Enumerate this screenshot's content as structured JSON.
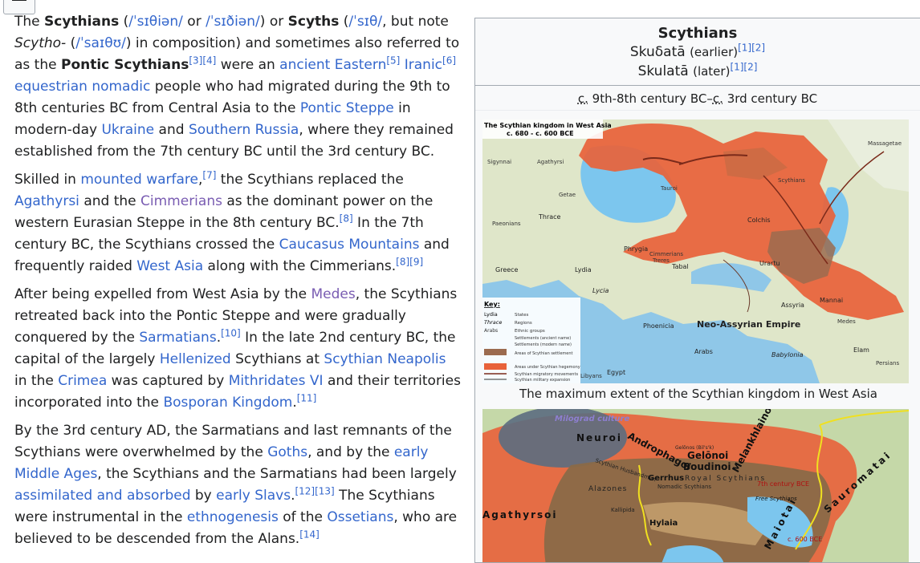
{
  "article": {
    "p1": {
      "t1": "The ",
      "name1": "Scythians",
      "t2": " (",
      "ipa1": "/ˈsɪθiən/",
      "t3": " or ",
      "ipa2": "/ˈsɪðiən/",
      "t4": ") or ",
      "name2": "Scyths",
      "t5": " (",
      "ipa3": "/ˈsɪθ/",
      "t6": ", but note ",
      "prefix": "Scytho-",
      "t7": " (",
      "ipa4": "/ˈsaɪθʊ/",
      "t8": ") in composition) and sometimes also referred to as the ",
      "name3": "Pontic Scythians",
      "ref1": "[3][4]",
      "t9": " were an ",
      "link1": "ancient Eastern",
      "ref2": "[5]",
      "t10": " ",
      "link2": "Iranic",
      "ref3": "[6]",
      "t11": " ",
      "link3": "equestrian nomadic",
      "t12": " people who had migrated during the 9th to 8th centuries BC from Central Asia to the ",
      "link4": "Pontic Steppe",
      "t13": " in modern-day ",
      "link5": "Ukraine",
      "t14": " and ",
      "link6": "Southern Russia",
      "t15": ", where they remained established from the 7th century BC until the 3rd century BC."
    },
    "p2": {
      "t1": "Skilled in ",
      "link1": "mounted warfare",
      "t2": ",",
      "ref1": "[7]",
      "t3": " the Scythians replaced the ",
      "link2": "Agathyrsi",
      "t4": " and the ",
      "link3": "Cimmerians",
      "t5": " as the dominant power on the western Eurasian Steppe in the 8th century BC.",
      "ref2": "[8]",
      "t6": " In the 7th century BC, the Scythians crossed the ",
      "link4": "Caucasus Mountains",
      "t7": " and frequently raided ",
      "link5": "West Asia",
      "t8": " along with the Cimmerians.",
      "ref3": "[8][9]"
    },
    "p3": {
      "t1": "After being expelled from West Asia by the ",
      "link1": "Medes",
      "t2": ", the Scythians retreated back into the Pontic Steppe and were gradually conquered by the ",
      "link2": "Sarmatians",
      "t3": ".",
      "ref1": "[10]",
      "t4": " In the late 2nd century BC, the capital of the largely ",
      "link3": "Hellenized",
      "t5": " Scythians at ",
      "link4": "Scythian Neapolis",
      "t6": " in the ",
      "link5": "Crimea",
      "t7": " was captured by ",
      "link6": "Mithridates VI",
      "t8": " and their territories incorporated into the ",
      "link7": "Bosporan Kingdom",
      "t9": ".",
      "ref2": "[11]"
    },
    "p4": {
      "t1": "By the 3rd century AD, the Sarmatians and last remnants of the Scythians were overwhelmed by the ",
      "link1": "Goths",
      "t2": ", and by the ",
      "link2": "early Middle Ages",
      "t3": ", the Scythians and the Sarmatians had been largely ",
      "link3": "assimilated and absorbed",
      "t4": " by ",
      "link4": "early Slavs",
      "t5": ".",
      "ref1": "[12][13]",
      "t6": " The Scythians were instrumental in the ",
      "link5": "ethnogenesis",
      "t7": " of the ",
      "link6": "Ossetians",
      "t8": ", who are believed to be descended from the Alans.",
      "ref2": "[14]"
    }
  },
  "infobox": {
    "title": "Scythians",
    "name_early": "Skuδatā",
    "name_early_note": "(earlier)",
    "name_early_ref": "[1][2]",
    "name_late": "Skulatā",
    "name_late_note": "(later)",
    "name_late_ref": "[1][2]",
    "date_c1": "c.",
    "date_mid": " 9th-8th century BC–",
    "date_c2": "c.",
    "date_end": " 3rd century BC",
    "map1_caption": "The maximum extent of the Scythian kingdom in West Asia",
    "map1_labels": {
      "title_line1": "The Scythian kingdom in West Asia",
      "title_line2": "c. 680 - c. 600 BCE",
      "signynai": "Sigynnai",
      "agathyrsi": "Agathyrsi",
      "getae": "Getae",
      "tauroi": "Tauroi",
      "thrace": "Thrace",
      "paeonians": "Paeonians",
      "colchis": "Colchis",
      "massagetae": "Massagetae",
      "scythians": "Scythians",
      "phrygia": "Phrygia",
      "cimmerians": "Cimmerians",
      "treres": "Treres",
      "tabal": "Tabal",
      "urartu": "Urartu",
      "greece": "Greece",
      "lydia": "Lydia",
      "lycia": "Lycia",
      "assyria": "Assyria",
      "mannai": "Mannai",
      "medes": "Medes",
      "phoenicia": "Phoenicia",
      "neo_assyrian": "Neo-Assyrian Empire",
      "arabs": "Arabs",
      "babylonia": "Babylonia",
      "elam": "Elam",
      "persians": "Persians",
      "libyans": "Libyans",
      "egypt": "Egypt",
      "key_title": "Key:",
      "key_lydia": "Lydia",
      "key_thrace": "Thrace",
      "key_arabs": "Arabs",
      "key_states": "States",
      "key_regions": "Regions",
      "key_ethnic": "Ethnic groups",
      "key_settlements_ancient": "Settlements (ancient name)",
      "key_settlements_modern": "Settlements (modern name)",
      "key_scythian_settlement": "Areas of Scythian settlement",
      "key_hegemony": "Areas under Scythian hegemony",
      "key_migratory": "Scythian migratory movements",
      "key_military": "Scythian military expansion"
    },
    "map2_labels": {
      "milograd": "Milograd culture",
      "neuroi": "Neuroi",
      "androphagoi": "Androphagoi",
      "gelonoi": "Gelōnoi",
      "boudinoi": "Boudinoi",
      "melankhlainoi": "Melankhlainoi",
      "gelonos": "Gelōnos (Bil's'k)",
      "scythian_husbandmen": "Scythian Husbandmen",
      "gerrhus": "Gerrhus",
      "royal_scythians": "Royal Scythians",
      "alazones": "Alazones",
      "nomadic_scythians": "Nomadic Scythians",
      "seventh_century": "7th century BCE",
      "free_scythians": "Free Scythians",
      "agathyrsoi": "Agathyrsoi",
      "sauromatai": "Sauromatai",
      "maiotai": "Maiotai",
      "hylaia": "Hylaia",
      "kallipida": "Kallipida",
      "c600": "c. 600 BCE"
    }
  }
}
